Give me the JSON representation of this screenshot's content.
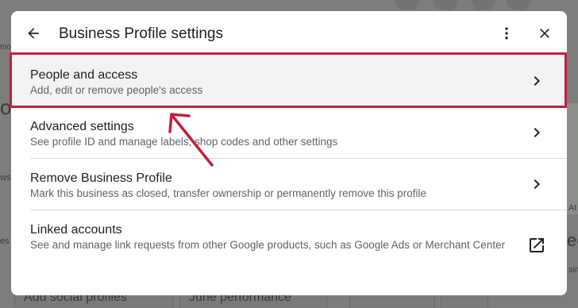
{
  "dialog": {
    "title": "Business Profile settings",
    "back_icon": "arrow-back-icon",
    "more_icon": "more-vert-icon",
    "close_icon": "close-icon"
  },
  "items": [
    {
      "title": "People and access",
      "subtitle": "Add, edit or remove people's access",
      "icon": "chevron-right-icon"
    },
    {
      "title": "Advanced settings",
      "subtitle": "See profile ID and manage labels, shop codes and other settings",
      "icon": "chevron-right-icon"
    },
    {
      "title": "Remove Business Profile",
      "subtitle": "Mark this business as closed, transfer ownership or permanently remove this profile",
      "icon": "chevron-right-icon"
    },
    {
      "title": "Linked accounts",
      "subtitle": "See and manage link requests from other Google products, such as Google Ads or Merchant Center",
      "icon": "open-in-new-icon"
    }
  ],
  "background": {
    "fragments": [
      "mop",
      "o",
      "ws",
      "es",
      "Add social profiles",
      "June performance",
      "ec",
      "sin",
      "At"
    ]
  },
  "annotation": {
    "highlight_color": "#c2203d"
  }
}
